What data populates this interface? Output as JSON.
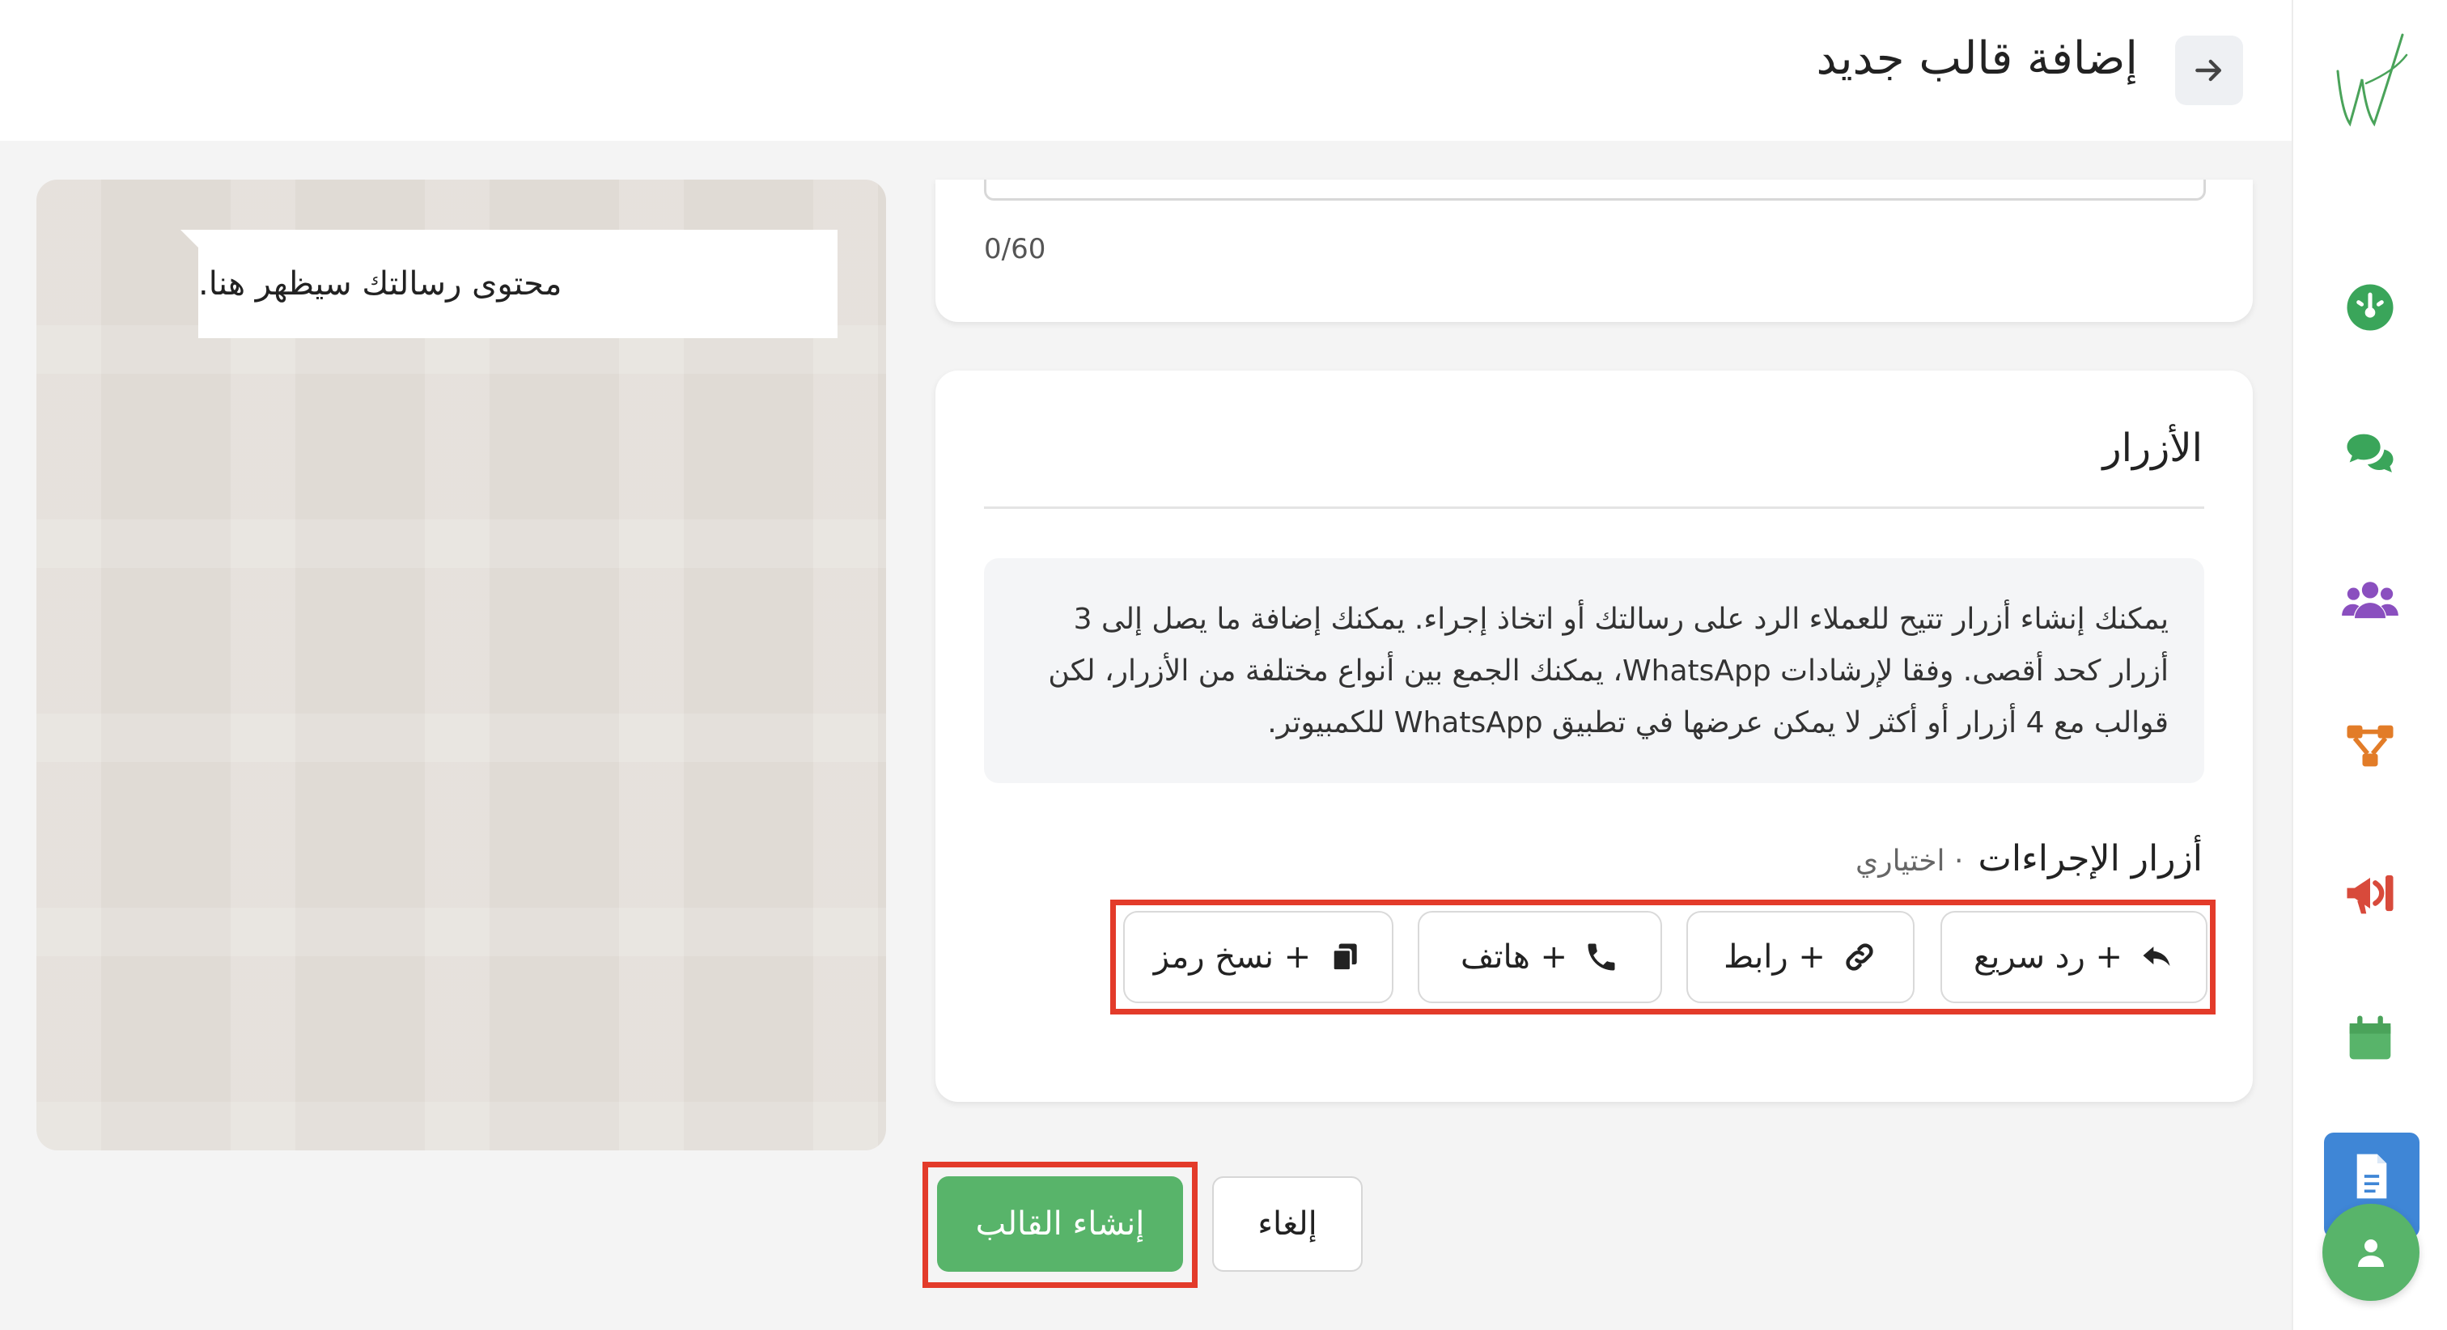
{
  "header": {
    "title": "إضافة قالب جديد",
    "back_icon": "arrow-right-icon"
  },
  "preview": {
    "message_placeholder": "محتوى رسالتك سيظهر هنا."
  },
  "body_text": {
    "counter": "0/60"
  },
  "buttons_section": {
    "title": "الأزرار",
    "info": "يمكنك إنشاء أزرار تتيح للعملاء الرد على رسالتك أو اتخاذ إجراء. يمكنك إضافة ما يصل إلى 3 أزرار كحد أقصى. وفقا لإرشادات WhatsApp، يمكنك الجمع بين أنواع مختلفة من الأزرار، لكن قوالب مع 4 أزرار أو أكثر لا يمكن عرضها في تطبيق WhatsApp للكمبيوتر.",
    "actions_label": "أزرار الإجراءات",
    "optional_label": "· اختياري",
    "options": [
      {
        "label": "+ رد سريع",
        "icon": "reply-icon"
      },
      {
        "label": "+ رابط",
        "icon": "link-icon"
      },
      {
        "label": "+ هاتف",
        "icon": "phone-icon"
      },
      {
        "label": "+ نسخ رمز",
        "icon": "copy-icon"
      }
    ]
  },
  "footer": {
    "create_label": "إنشاء القالب",
    "cancel_label": "إلغاء"
  },
  "sidebar": {
    "items": [
      "logo",
      "dashboard-icon",
      "chat-icon",
      "contacts-icon",
      "flows-icon",
      "campaigns-icon",
      "calendar-icon",
      "templates-icon",
      "profile-icon"
    ]
  },
  "colors": {
    "accent": "#58b46a",
    "highlight": "#e33b2a",
    "active_nav": "#3f86d6"
  }
}
